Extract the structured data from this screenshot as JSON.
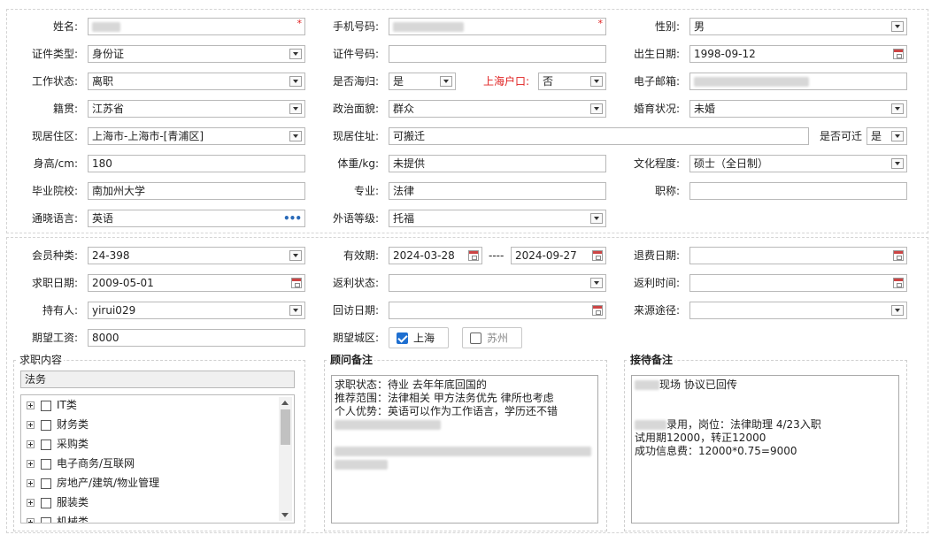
{
  "personal": {
    "name_label": "姓名:",
    "phone_label": "手机号码:",
    "gender_label": "性别:",
    "gender_value": "男",
    "id_type_label": "证件类型:",
    "id_type_value": "身份证",
    "id_no_label": "证件号码:",
    "birth_label": "出生日期:",
    "birth_value": "1998-09-12",
    "work_status_label": "工作状态:",
    "work_status_value": "离职",
    "returnee_label": "是否海归:",
    "returnee_value": "是",
    "shanghai_hukou_label": "上海户口:",
    "shanghai_hukou_value": "否",
    "email_label": "电子邮箱:",
    "native_label": "籍贯:",
    "native_value": "江苏省",
    "political_label": "政治面貌:",
    "political_value": "群众",
    "marital_label": "婚育状况:",
    "marital_value": "未婚",
    "residence_area_label": "现居住区:",
    "residence_area_value": "上海市-上海市-[青浦区]",
    "address_label": "现居住址:",
    "address_value": "可搬迁",
    "relocate_label": "是否可迁",
    "relocate_value": "是",
    "height_label": "身高/cm:",
    "height_value": "180",
    "weight_label": "体重/kg:",
    "weight_value": "未提供",
    "education_label": "文化程度:",
    "education_value": "硕士（全日制）",
    "school_label": "毕业院校:",
    "school_value": "南加州大学",
    "major_label": "专业:",
    "major_value": "法律",
    "title_label": "职称:",
    "language_label": "通晓语言:",
    "language_value": "英语",
    "language_more": "•••",
    "foreign_level_label": "外语等级:",
    "foreign_level_value": "托福"
  },
  "membership": {
    "member_type_label": "会员种类:",
    "member_type_value": "24-398",
    "validity_label": "有效期:",
    "validity_start": "2024-03-28",
    "validity_sep": "----",
    "validity_end": "2024-09-27",
    "refund_date_label": "退费日期:",
    "job_date_label": "求职日期:",
    "job_date_value": "2009-05-01",
    "rebate_status_label": "返利状态:",
    "rebate_time_label": "返利时间:",
    "holder_label": "持有人:",
    "holder_value": "yirui029",
    "visit_date_label": "回访日期:",
    "source_label": "来源途径:",
    "salary_label": "期望工资:",
    "salary_value": "8000",
    "city_label": "期望城区:",
    "city_options": [
      {
        "label": "上海",
        "checked": true
      },
      {
        "label": "苏州",
        "checked": false
      }
    ]
  },
  "job_content": {
    "title": "求职内容",
    "search_value": "法务",
    "categories": [
      "IT类",
      "财务类",
      "采购类",
      "电子商务/互联网",
      "房地产/建筑/物业管理",
      "服装类",
      "机械类"
    ]
  },
  "consultant_notes": {
    "title": "顾问备注",
    "lines": [
      "求职状态：待业  去年年底回国的",
      "推荐范围：法律相关 甲方法务优先 律所也考虑",
      "个人优势：英语可以作为工作语言，学历还不错"
    ]
  },
  "reception_notes": {
    "title": "接待备注",
    "line1": "现场 协议已回传",
    "line2": "录用，岗位：法律助理  4/23入职",
    "line3": "试用期12000，转正12000",
    "line4": "成功信息费：12000*0.75=9000"
  }
}
